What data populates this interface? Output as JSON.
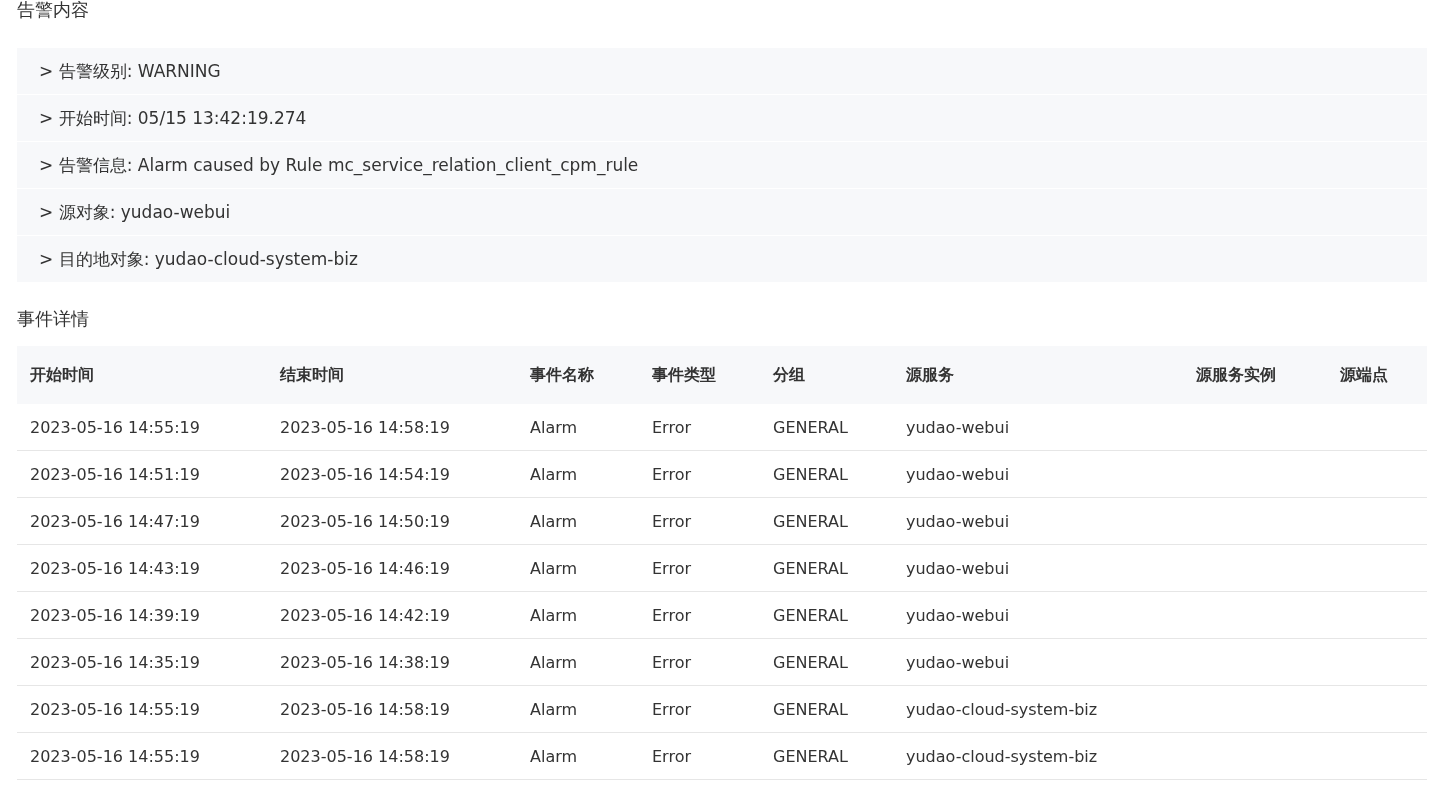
{
  "alert_section": {
    "title": "告警内容",
    "items": [
      "> 告警级别: WARNING",
      "> 开始时间: 05/15 13:42:19.274",
      "> 告警信息: Alarm caused by Rule mc_service_relation_client_cpm_rule",
      "> 源对象: yudao-webui",
      "> 目的地对象: yudao-cloud-system-biz"
    ]
  },
  "event_section": {
    "title": "事件详情",
    "table": {
      "columns": [
        "开始时间",
        "结束时间",
        "事件名称",
        "事件类型",
        "分组",
        "源服务",
        "源服务实例",
        "源端点"
      ],
      "rows": [
        [
          "2023-05-16 14:55:19",
          "2023-05-16 14:58:19",
          "Alarm",
          "Error",
          "GENERAL",
          "yudao-webui"
        ],
        [
          "2023-05-16 14:51:19",
          "2023-05-16 14:54:19",
          "Alarm",
          "Error",
          "GENERAL",
          "yudao-webui"
        ],
        [
          "2023-05-16 14:47:19",
          "2023-05-16 14:50:19",
          "Alarm",
          "Error",
          "GENERAL",
          "yudao-webui"
        ],
        [
          "2023-05-16 14:43:19",
          "2023-05-16 14:46:19",
          "Alarm",
          "Error",
          "GENERAL",
          "yudao-webui"
        ],
        [
          "2023-05-16 14:39:19",
          "2023-05-16 14:42:19",
          "Alarm",
          "Error",
          "GENERAL",
          "yudao-webui"
        ],
        [
          "2023-05-16 14:35:19",
          "2023-05-16 14:38:19",
          "Alarm",
          "Error",
          "GENERAL",
          "yudao-webui"
        ],
        [
          "2023-05-16 14:55:19",
          "2023-05-16 14:58:19",
          "Alarm",
          "Error",
          "GENERAL",
          "yudao-cloud-system-biz"
        ],
        [
          "2023-05-16 14:55:19",
          "2023-05-16 14:58:19",
          "Alarm",
          "Error",
          "GENERAL",
          "yudao-cloud-system-biz"
        ]
      ]
    }
  }
}
